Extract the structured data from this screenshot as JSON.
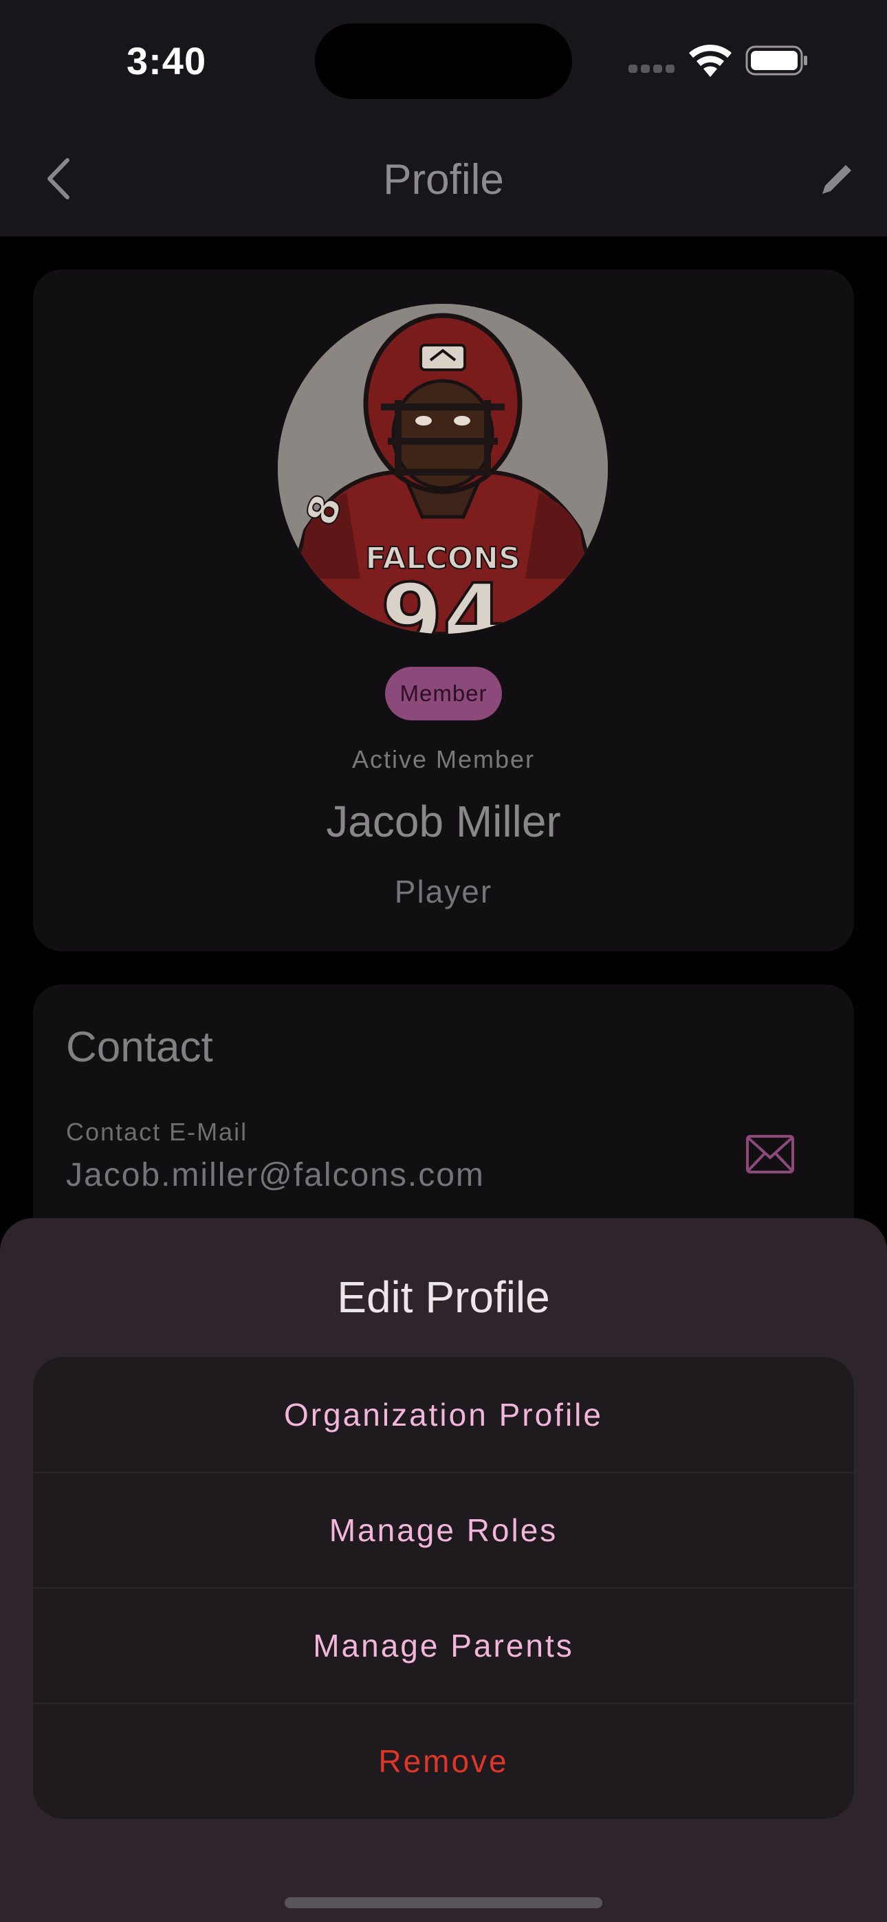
{
  "status_bar": {
    "time": "3:40"
  },
  "nav": {
    "title": "Profile",
    "back_icon": "chevron-left-icon",
    "edit_icon": "pencil-icon"
  },
  "profile": {
    "badge": "Member",
    "status": "Active Member",
    "name": "Jacob Miller",
    "role": "Player",
    "avatar": {
      "jersey_text": "FALCONS",
      "jersey_number": "94",
      "sleeve_number": "8"
    }
  },
  "contact": {
    "title": "Contact",
    "email_label": "Contact E-Mail",
    "email_value": "Jacob.miller@falcons.com",
    "email_icon": "envelope-icon"
  },
  "sheet": {
    "title": "Edit Profile",
    "items": [
      {
        "label": "Organization Profile"
      },
      {
        "label": "Manage Roles"
      },
      {
        "label": "Manage Parents"
      },
      {
        "label": "Remove"
      }
    ]
  },
  "colors": {
    "accent": "#f2b6da",
    "danger": "#e0362a",
    "badge": "#8c4a7b",
    "sheet_background": "#2e252c"
  }
}
